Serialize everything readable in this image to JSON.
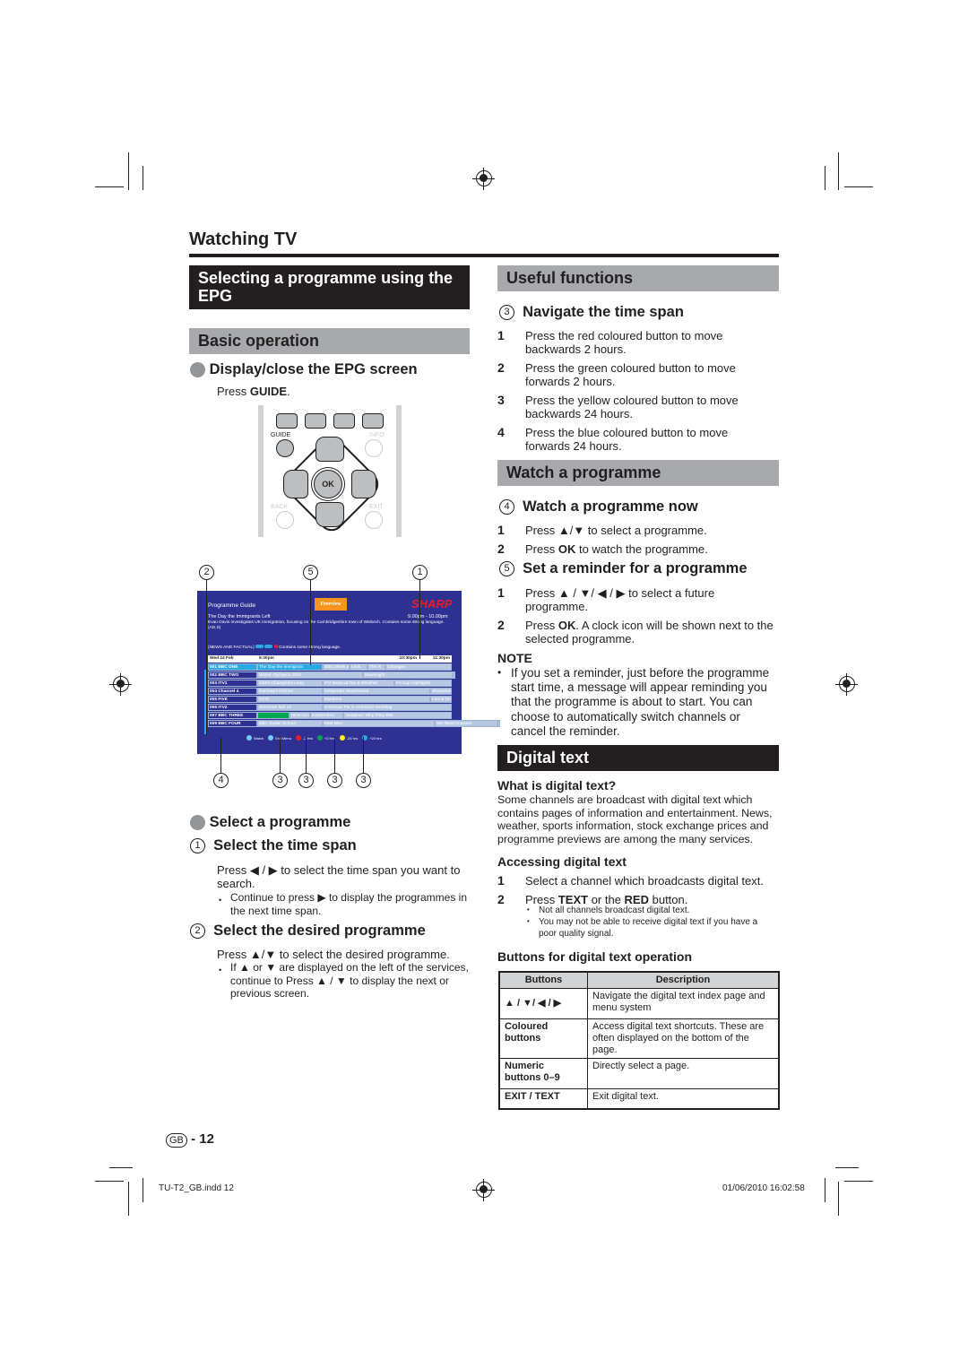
{
  "header": {
    "title": "Watching TV"
  },
  "left": {
    "epg_section": {
      "title": "Selecting a programme using the EPG"
    },
    "basic": {
      "title": "Basic operation",
      "display": {
        "title": "Display/close the EPG screen",
        "press": "Press ",
        "key": "GUIDE",
        "end": "."
      },
      "remote": {
        "guide": "GUIDE",
        "info": "INFO",
        "back": "BACK",
        "exit": "EXIT",
        "ok": "OK"
      }
    },
    "callouts_top": [
      "2",
      "5",
      "1"
    ],
    "callouts_bottom": [
      "4",
      "3",
      "3",
      "3",
      "3"
    ],
    "epg": {
      "title": "Programme Guide",
      "freeview": "Freeview",
      "brand": "SHARP",
      "prog_title": "The Day the Immigrants Left",
      "prog_time": "9.00pm - 10.00pm",
      "prog_desc": "Evan Davis investigates UK immigration, focusing on the Cambridgeshire town of Wisbech. Contains some strong language. (AD,S)",
      "genre": "(NEWS AND FACTUAL)",
      "warning": "Contains some strong language.",
      "date": "Wed 24 Feb",
      "times": [
        "9:30pm",
        "10:30pm",
        "11:30pm"
      ],
      "rows": [
        {
          "ch": "001  BBC ONE",
          "progs": [
            "The Day the Immigrant",
            "BBC News at Ten",
            "Look",
            "The R",
            "Damages"
          ]
        },
        {
          "ch": "002  BBC TWO",
          "progs": [
            "Winter Olympics 2010",
            "Newsnight",
            "Winte"
          ]
        },
        {
          "ch": "003  ITV1",
          "progs": [
            "UEFA Champions Leag",
            "ITV News at Ten & Weather",
            "FA Cup Highlights"
          ]
        },
        {
          "ch": "004  Channel 4",
          "progs": [
            "Ramsay's Kitchen",
            "Desperate Housewives",
            "Shameless"
          ]
        },
        {
          "ch": "005  FIVE",
          "progs": [
            "NCIS",
            "Numbers",
            "Law & Order: Criminal I"
          ]
        },
        {
          "ch": "006  ITV2",
          "progs": [
            "American Idol 12",
            "American Pie 3: American Wedding"
          ]
        },
        {
          "ch": "007  BBC THREE",
          "progs": [
            "",
            "Most Ann",
            "EastEnders",
            "Vampires: Why They Bite"
          ]
        },
        {
          "ch": "009  BBC FOUR",
          "progs": [
            "BBC Syrian School",
            "Mad Men",
            "We Need Answers",
            "It's C"
          ]
        }
      ],
      "legend": [
        "Watch",
        "Exit Menu",
        "-2 Hrs",
        "+2 Hrs",
        "-24 hrs",
        "+24 hrs"
      ],
      "colors": {
        "bg": "#2e3192",
        "selected": "#29abe2",
        "red": "#ed1c24",
        "green": "#00a651",
        "yellow": "#fff200",
        "blue": "#29abe2"
      }
    },
    "select": {
      "title": "Select a programme",
      "step1": {
        "num": "1",
        "title": "Select the time span",
        "text": "Press ◀ / ▶ to select the time span you want to search.",
        "bullet": "Continue to press ▶ to display the programmes in the next time span."
      },
      "step2": {
        "num": "2",
        "title": "Select the desired programme",
        "text": "Press ▲/▼ to select the desired programme.",
        "bullet": "If ▲ or ▼ are displayed on the left of the services, continue to Press ▲ / ▼ to display the next or previous screen."
      }
    }
  },
  "right": {
    "useful": {
      "title": "Useful functions",
      "sub": {
        "num": "3",
        "title": "Navigate the time span"
      },
      "items": [
        {
          "n": "1",
          "text": "Press the red coloured button to move backwards 2 hours."
        },
        {
          "n": "2",
          "text": "Press the green coloured button to move forwards 2 hours."
        },
        {
          "n": "3",
          "text": "Press the yellow coloured button to move backwards 24 hours."
        },
        {
          "n": "4",
          "text": "Press the blue coloured button to move forwards 24 hours."
        }
      ]
    },
    "watch": {
      "title": "Watch a programme",
      "now": {
        "num": "4",
        "title": "Watch a programme now",
        "items": [
          {
            "n": "1",
            "pre": "Press ",
            "b": "",
            "text": "▲/▼ to select a programme."
          },
          {
            "n": "2",
            "pre": "Press ",
            "b": "OK",
            "text": " to watch the programme."
          }
        ]
      },
      "reminder": {
        "num": "5",
        "title": "Set a reminder for a programme",
        "items": [
          {
            "n": "1",
            "pre": "Press ",
            "b": "",
            "text": "▲ / ▼/ ◀ / ▶ to select a future programme."
          },
          {
            "n": "2",
            "pre": "Press ",
            "b": "OK",
            "text": ". A clock icon will be shown next to the selected programme."
          }
        ]
      },
      "note_label": "NOTE",
      "note": "If you set a reminder, just before the programme start time, a message will appear reminding you that the programme is about to start. You can choose to automatically switch channels or cancel the reminder."
    },
    "digital": {
      "title": "Digital text",
      "what_title": "What is digital text?",
      "what_text": "Some channels are broadcast with digital text which contains pages of information and entertainment. News, weather, sports information, stock exchange prices and programme previews are among the many services.",
      "access_title": "Accessing digital text",
      "access_1": "Select a channel which broadcasts digital text.",
      "access_2_pre": "Press ",
      "access_2_b1": "TEXT",
      "access_2_mid": " or the ",
      "access_2_b2": "RED",
      "access_2_end": " button.",
      "access_bullets": [
        "Not all channels broadcast digital text.",
        "You may not be able to receive digital text if you have a poor quality signal."
      ],
      "buttons_title": "Buttons for digital text operation",
      "table": {
        "headers": [
          "Buttons",
          "Description"
        ],
        "rows": [
          {
            "k": "▲ / ▼/ ◀ / ▶",
            "v": "Navigate the digital text index page and menu system"
          },
          {
            "k": "Coloured buttons",
            "v": "Access digital text shortcuts. These are often displayed on the bottom of the page."
          },
          {
            "k": "Numeric buttons 0–9",
            "v": "Directly select a page."
          },
          {
            "k": "EXIT / TEXT",
            "v": "Exit digital text."
          }
        ]
      }
    }
  },
  "footer": {
    "region": "GB",
    "page": "- 12",
    "file": "TU-T2_GB.indd   12",
    "date": "01/06/2010   16:02:58"
  }
}
